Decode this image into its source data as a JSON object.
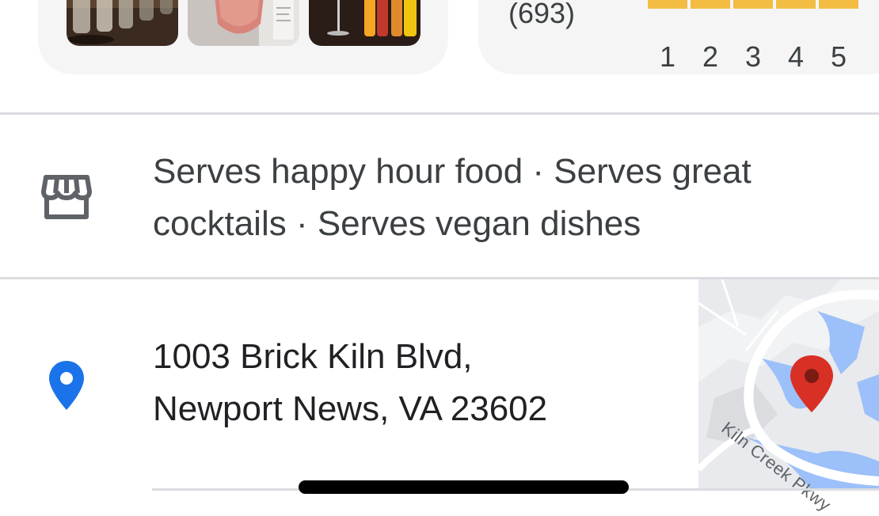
{
  "rating": {
    "review_count": "(693)",
    "histogram_labels": [
      "1",
      "2",
      "3",
      "4",
      "5"
    ],
    "bar_color": "#f2bd42"
  },
  "photos": [
    {
      "name": "drinks-photo-1"
    },
    {
      "name": "drinks-photo-2"
    },
    {
      "name": "drinks-photo-3"
    }
  ],
  "attributes": {
    "icon": "storefront-icon",
    "line1": "Serves happy hour food · Serves great",
    "line2": "cocktails · Serves vegan dishes"
  },
  "address": {
    "icon": "location-pin-icon",
    "line1": "1003 Brick Kiln Blvd,",
    "line2": "Newport News, VA 23602",
    "map_street_label": "Kiln Creek Pkwy",
    "pin_color": "#1a73e8",
    "map_marker_color": "#d93025"
  }
}
